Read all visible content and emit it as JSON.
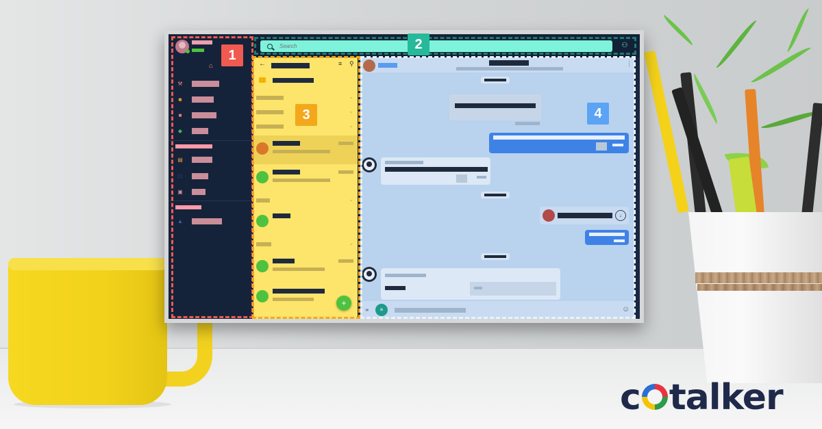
{
  "search": {
    "placeholder": "Search"
  },
  "annotations": [
    {
      "number": "1",
      "color": "#f05a50"
    },
    {
      "number": "2",
      "color": "#26b99a"
    },
    {
      "number": "3",
      "color": "#f3a81c"
    },
    {
      "number": "4",
      "color": "#5aa3f5"
    }
  ],
  "fab": {
    "label": "+"
  },
  "brand": {
    "before": "c",
    "after": "talker"
  },
  "colors": {
    "sidebar": "#15233a",
    "search_bar": "#7ef2da",
    "chat_list": "#fde46a",
    "conversation": "#b9d2ee",
    "outgoing_bubble": "#3e82e6",
    "online": "#4ec23e"
  },
  "icons": {
    "home": "home-icon",
    "search": "search-icon",
    "contacts": "contacts-icon",
    "back": "back-arrow-icon",
    "filter": "filter-icon",
    "attach": "paperclip-icon",
    "emoji": "emoji-icon",
    "quick_replies": "list-icon",
    "menu": "more-vertical-icon",
    "download": "download-icon"
  }
}
